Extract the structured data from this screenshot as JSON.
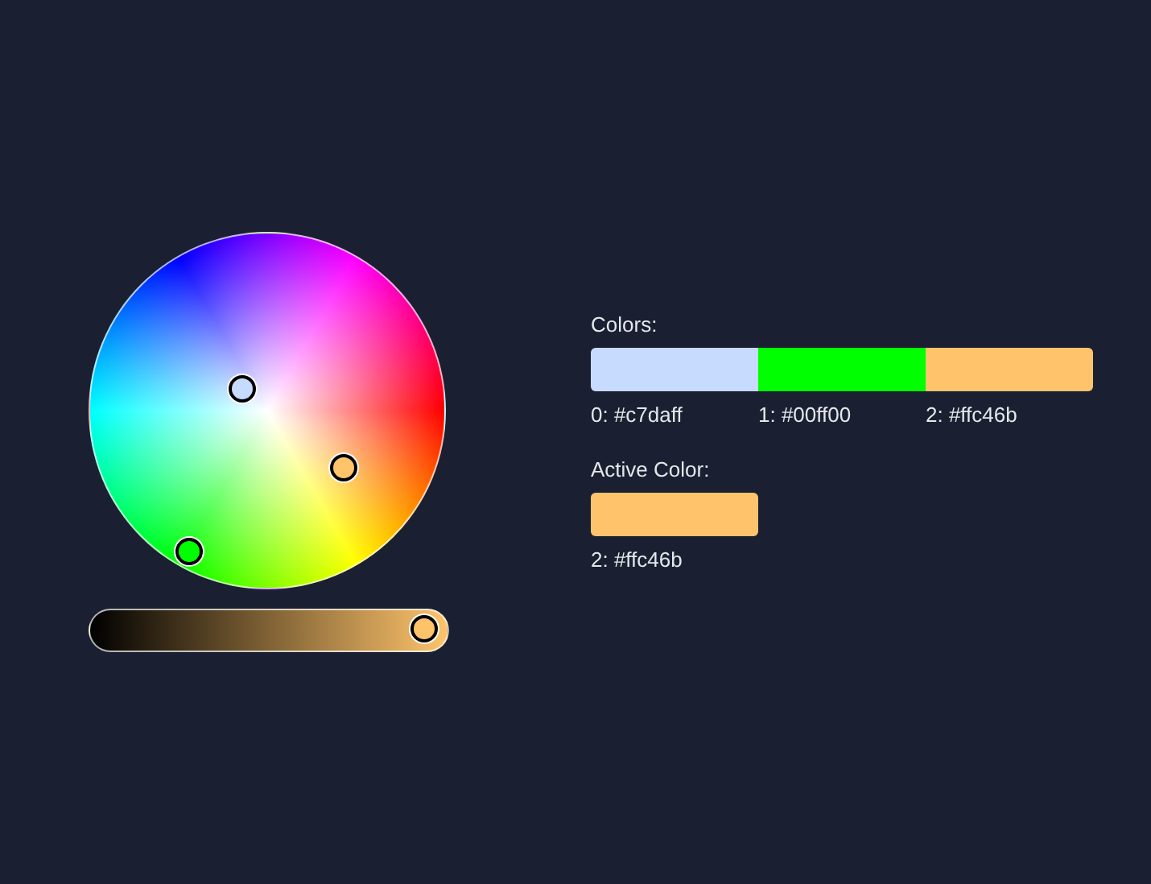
{
  "wheel": {
    "handles": [
      {
        "color": "#c7daff"
      },
      {
        "color": "#00ff00"
      },
      {
        "color": "#ffc46b"
      }
    ]
  },
  "brightness": {
    "color": "#ffc46b",
    "level": 1
  },
  "colors": {
    "title": "Colors:",
    "items": [
      {
        "label": "0: #c7daff",
        "color": "#c7daff"
      },
      {
        "label": "1: #00ff00",
        "color": "#00ff00"
      },
      {
        "label": "2: #ffc46b",
        "color": "#ffc46b"
      }
    ]
  },
  "active_color": {
    "title": "Active Color:",
    "color": "#ffc46b",
    "label": "2: #ffc46b"
  }
}
